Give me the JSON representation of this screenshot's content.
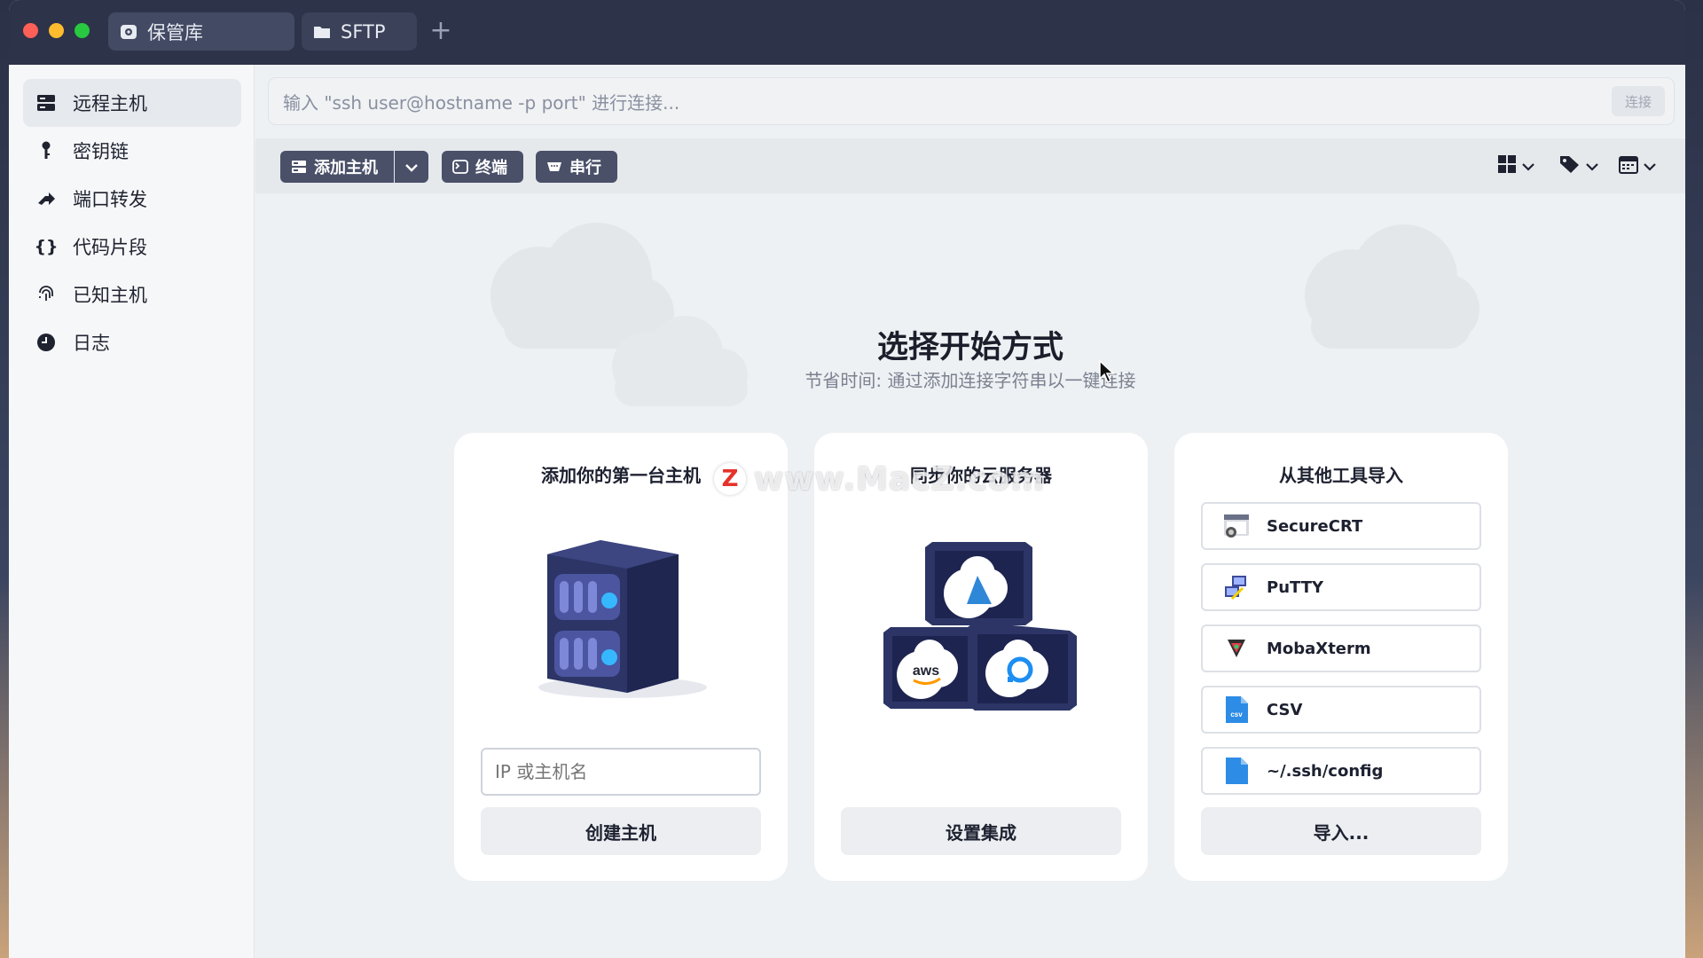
{
  "titlebar": {
    "tabs": [
      {
        "label": "保管库",
        "icon": "vault-icon"
      },
      {
        "label": "SFTP",
        "icon": "folder-icon"
      }
    ],
    "add_tab": "+"
  },
  "sidebar": {
    "items": [
      {
        "label": "远程主机",
        "icon": "server-icon",
        "active": true
      },
      {
        "label": "密钥链",
        "icon": "key-icon"
      },
      {
        "label": "端口转发",
        "icon": "port-forward-icon"
      },
      {
        "label": "代码片段",
        "icon": "braces-icon"
      },
      {
        "label": "已知主机",
        "icon": "fingerprint-icon"
      },
      {
        "label": "日志",
        "icon": "clock-icon"
      }
    ]
  },
  "search": {
    "placeholder": "输入 \"ssh user@hostname -p port\" 进行连接...",
    "connect_label": "连接"
  },
  "toolbar": {
    "add_host": "添加主机",
    "terminal": "终端",
    "serial": "串行"
  },
  "main": {
    "title": "选择开始方式",
    "subtitle": "节省时间: 通过添加连接字符串以一键连接"
  },
  "cards": {
    "add_host": {
      "title": "添加你的第一台主机",
      "input_placeholder": "IP 或主机名",
      "button": "创建主机"
    },
    "cloud": {
      "title": "同步你的云服务器",
      "button": "设置集成"
    },
    "import": {
      "title": "从其他工具导入",
      "items": [
        "SecureCRT",
        "PuTTY",
        "MobaXterm",
        "CSV",
        "~/.ssh/config"
      ],
      "button": "导入..."
    }
  },
  "watermark": "www.MacZ.com",
  "colors": {
    "titlebar": "#2d3349",
    "toolbar_button": "#4a5068",
    "card_bg": "#ffffff",
    "app_bg": "#eef1f3"
  }
}
